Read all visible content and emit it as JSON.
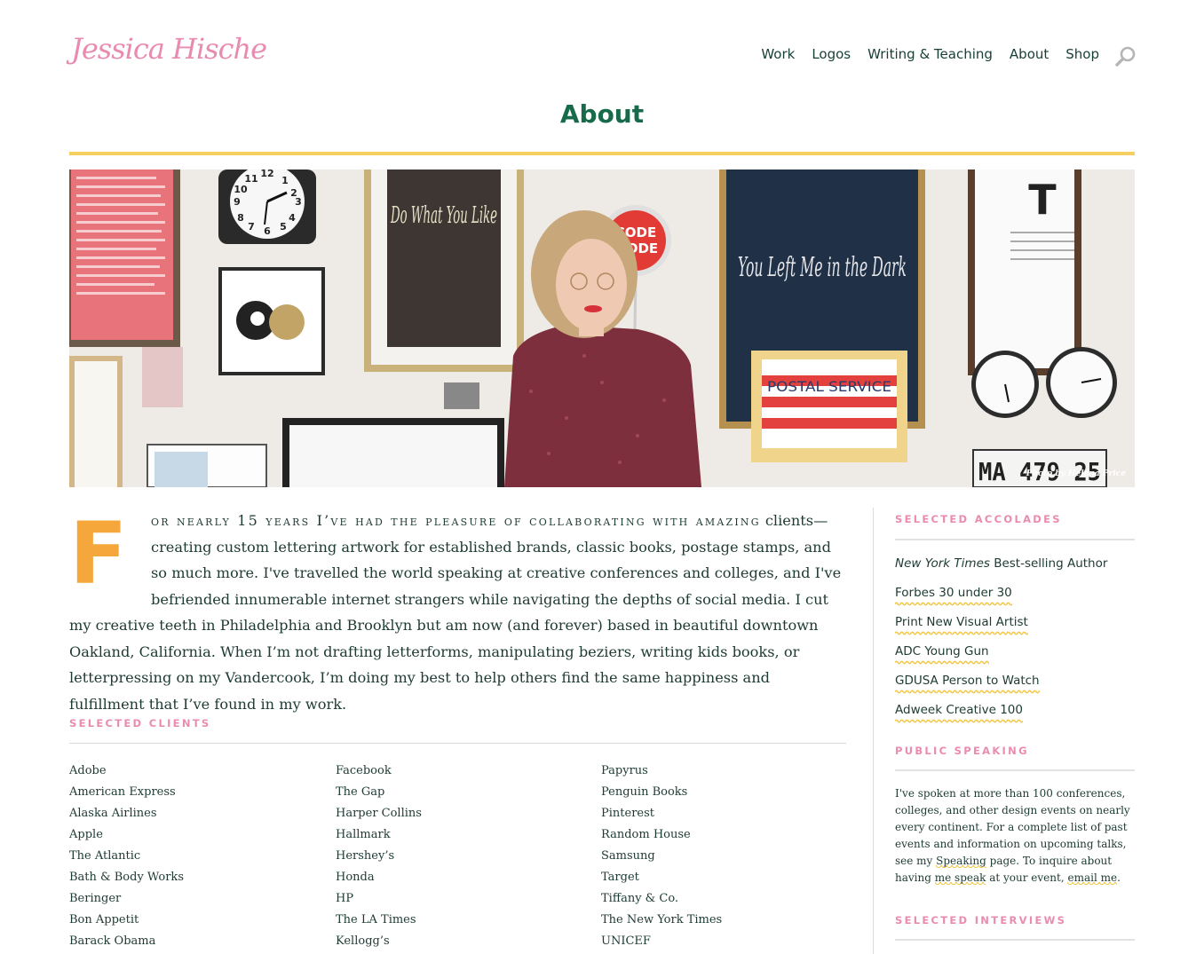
{
  "header": {
    "logo_text": "Jessica Hische",
    "nav": [
      {
        "label": "Work"
      },
      {
        "label": "Logos"
      },
      {
        "label": "Writing & Teaching"
      },
      {
        "label": "About"
      },
      {
        "label": "Shop"
      }
    ],
    "search_icon": "search-icon"
  },
  "page": {
    "title": "About"
  },
  "hero": {
    "clock_numbers": [
      "12",
      "1",
      "2",
      "3",
      "4",
      "5",
      "6",
      "7",
      "8",
      "9",
      "10",
      "11"
    ],
    "poster_left_text": "Do What You Like",
    "poster_right_text": "You Left Me in the Dark",
    "sign_text_1": "CODE",
    "sign_text_2": "MODE",
    "postal_text": "POSTAL SERVICE",
    "eye_chart_letter": "T",
    "plate_text": "MA 479 25",
    "credit": "Photo by Helena Price"
  },
  "intro": {
    "dropcap": "F",
    "lead": "or nearly 15 years I’ve had the pleasure of collaborating with amazing",
    "body": " clients—creating custom lettering artwork for established brands, classic books, postage stamps, and so much more. I've travelled the world speaking at creative conferences and colleges, and I've befriended innumerable internet strangers while navigating the depths of social media. I cut my creative teeth in Philadelphia and Brooklyn but am now (and forever) based in beautiful downtown Oakland, California. When I’m not drafting letterforms, manipulating beziers, writing kids books, or letterpressing on my Vandercook, I’m doing my best to help others find the same happiness and fulfillment that I’ve found in my work."
  },
  "clients": {
    "label": "SELECTED CLIENTS",
    "columns": [
      [
        "Adobe",
        "American Express",
        "Alaska Airlines",
        "Apple",
        "The Atlantic",
        "Bath & Body Works",
        "Beringer",
        "Bon Appetit",
        "Barack Obama"
      ],
      [
        "Facebook",
        "The Gap",
        "Harper Collins",
        "Hallmark",
        "Hershey’s",
        "Honda",
        "HP",
        "The LA Times",
        "Kellogg’s"
      ],
      [
        "Papyrus",
        "Penguin Books",
        "Pinterest",
        "Random House",
        "Samsung",
        "Target",
        "Tiffany & Co.",
        "The New York Times",
        "UNICEF"
      ]
    ]
  },
  "accolades": {
    "label": "SELECTED ACCOLADES",
    "first_italic": "New York Times",
    "first_rest": " Best-selling Author",
    "items": [
      "Forbes 30 under 30",
      "Print New Visual Artist",
      "ADC Young Gun",
      "GDUSA Person to Watch",
      "Adweek Creative 100"
    ]
  },
  "speaking": {
    "label": "PUBLIC SPEAKING",
    "text_1": "I've spoken at more than 100 conferences, colleges, and other design events on nearly every continent. For a complete list of past events and information on upcoming talks, see my ",
    "link_1": "Speaking",
    "text_2": " page. To inquire about having ",
    "link_2": "me speak",
    "text_3": " at your event, ",
    "link_3": "email me",
    "text_4": "."
  },
  "interviews": {
    "label": "SELECTED INTERVIEWS"
  },
  "colors": {
    "logo_pink": "#e98ab0",
    "title_green": "#176a4a",
    "accent_yellow": "#f5cf5f",
    "dropcap_orange": "#f5a73b",
    "label_pink": "#ea8bb0",
    "text_dark": "#1d3a33"
  }
}
